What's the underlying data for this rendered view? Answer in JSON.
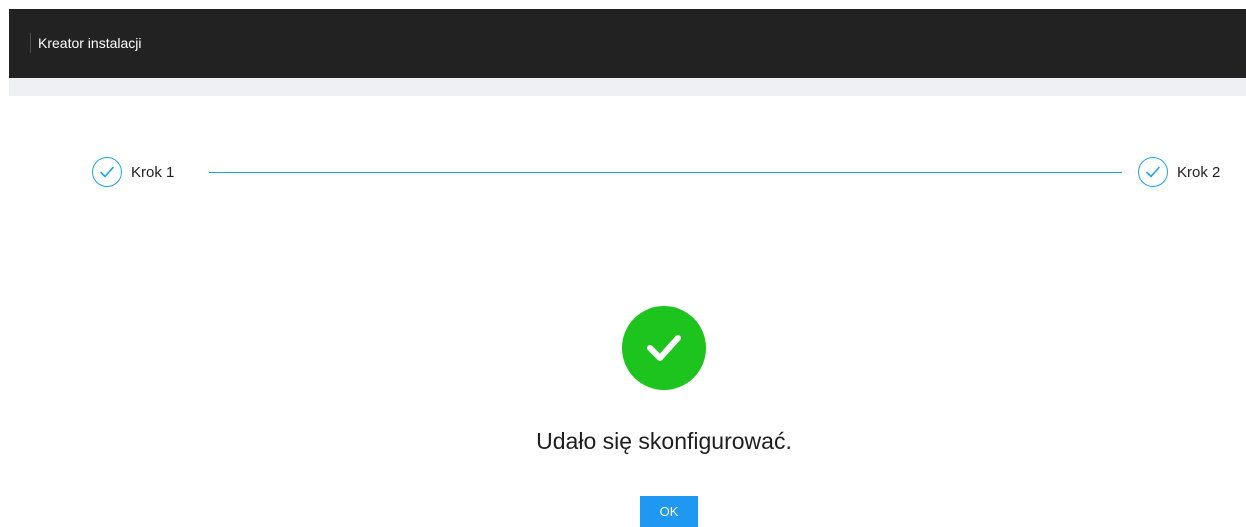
{
  "header": {
    "title": "Kreator instalacji"
  },
  "steps": [
    {
      "label": "Krok 1",
      "status": "completed",
      "icon": "check-icon"
    },
    {
      "label": "Krok 2",
      "status": "completed",
      "icon": "check-icon"
    }
  ],
  "result": {
    "icon": "success-check-icon",
    "message": "Udało się skonfigurować.",
    "ok_label": "OK"
  },
  "colors": {
    "header_bg": "#222222",
    "accent": "#1aa4ee",
    "success": "#1ec41e",
    "button": "#1e98f0"
  }
}
